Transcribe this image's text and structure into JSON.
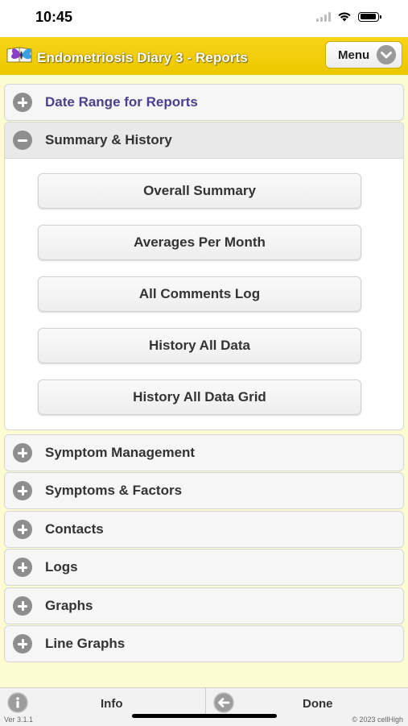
{
  "status_bar": {
    "time": "10:45"
  },
  "header": {
    "title": "Endometriosis Diary 3 - Reports",
    "menu_label": "Menu",
    "accent_color": "#f2cf0a"
  },
  "sections": [
    {
      "title": "Date Range for Reports",
      "icon": "plus-circle-icon",
      "expanded": false
    },
    {
      "title": "Summary & History",
      "icon": "minus-circle-icon",
      "expanded": true,
      "buttons": [
        "Overall Summary",
        "Averages Per Month",
        "All Comments Log",
        "History All Data",
        "History All Data Grid"
      ]
    },
    {
      "title": "Symptom Management",
      "icon": "plus-circle-icon",
      "expanded": false
    },
    {
      "title": "Symptoms & Factors",
      "icon": "plus-circle-icon",
      "expanded": false
    },
    {
      "title": "Contacts",
      "icon": "plus-circle-icon",
      "expanded": false
    },
    {
      "title": "Logs",
      "icon": "plus-circle-icon",
      "expanded": false
    },
    {
      "title": "Graphs",
      "icon": "plus-circle-icon",
      "expanded": false
    },
    {
      "title": "Line Graphs",
      "icon": "plus-circle-icon",
      "expanded": false
    }
  ],
  "footer": {
    "info_label": "Info",
    "done_label": "Done",
    "version": "Ver 3.1.1",
    "copyright": "© 2023 cellHigh"
  }
}
